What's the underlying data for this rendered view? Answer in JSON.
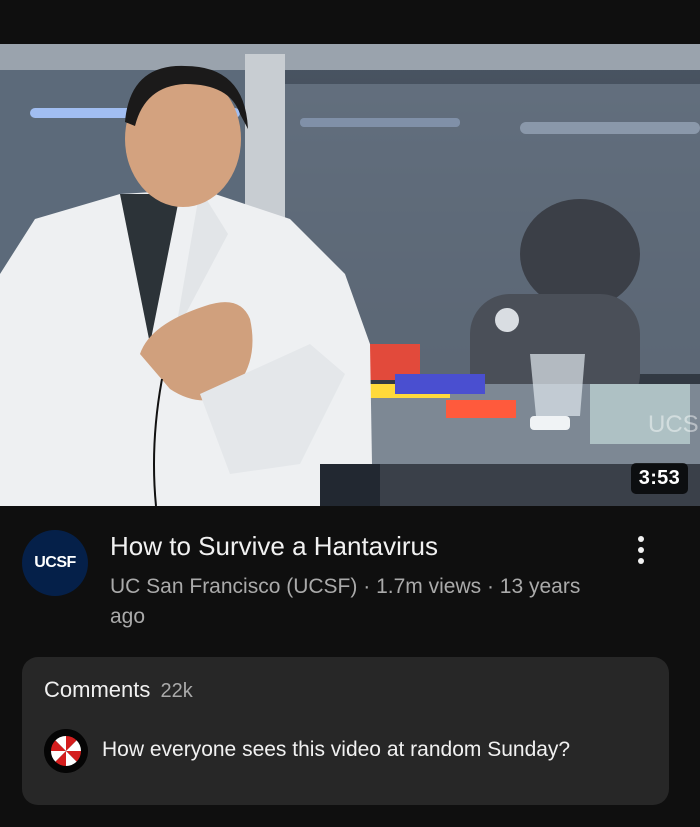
{
  "video": {
    "duration": "3:53",
    "title": "How to Survive a Hantavirus",
    "channel": "UC San Francisco (UCSF)",
    "views": "1.7m views",
    "age": "13 years ago",
    "separator": "·"
  },
  "channel_avatar": {
    "text": "UCSF",
    "bg_color": "#052049"
  },
  "comments": {
    "label": "Comments",
    "count": "22k",
    "top_comment": "How everyone sees this video at random Sunday?",
    "commenter_avatar_icon": "umbrella-logo-icon"
  },
  "colors": {
    "background": "#0f0f0f",
    "card": "#272727",
    "text_primary": "#f1f1f1",
    "text_secondary": "#aaaaaa"
  }
}
